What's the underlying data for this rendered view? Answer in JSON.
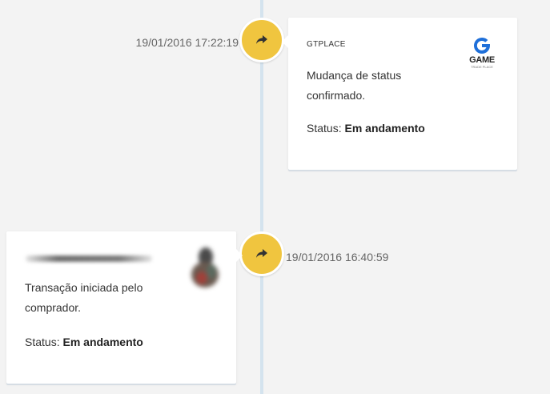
{
  "entries": [
    {
      "timestamp": "19/01/2016 17:22:19",
      "author": "GTPLACE",
      "logo_text": "GAME",
      "logo_subtext": "TRADE PLACE",
      "message": "Mudança de status confirmado.",
      "status_label": "Status:",
      "status_value": "Em andamento",
      "node_icon": "share-arrow-icon"
    },
    {
      "timestamp": "19/01/2016 16:40:59",
      "author": "",
      "message": "Transação iniciada pelo comprador.",
      "status_label": "Status:",
      "status_value": "Em andamento",
      "node_icon": "share-arrow-icon"
    }
  ],
  "colors": {
    "background": "#f3f3f3",
    "timeline_line": "#d4e3ee",
    "node": "#f0c53f",
    "logo_blue": "#1e6fd9"
  }
}
